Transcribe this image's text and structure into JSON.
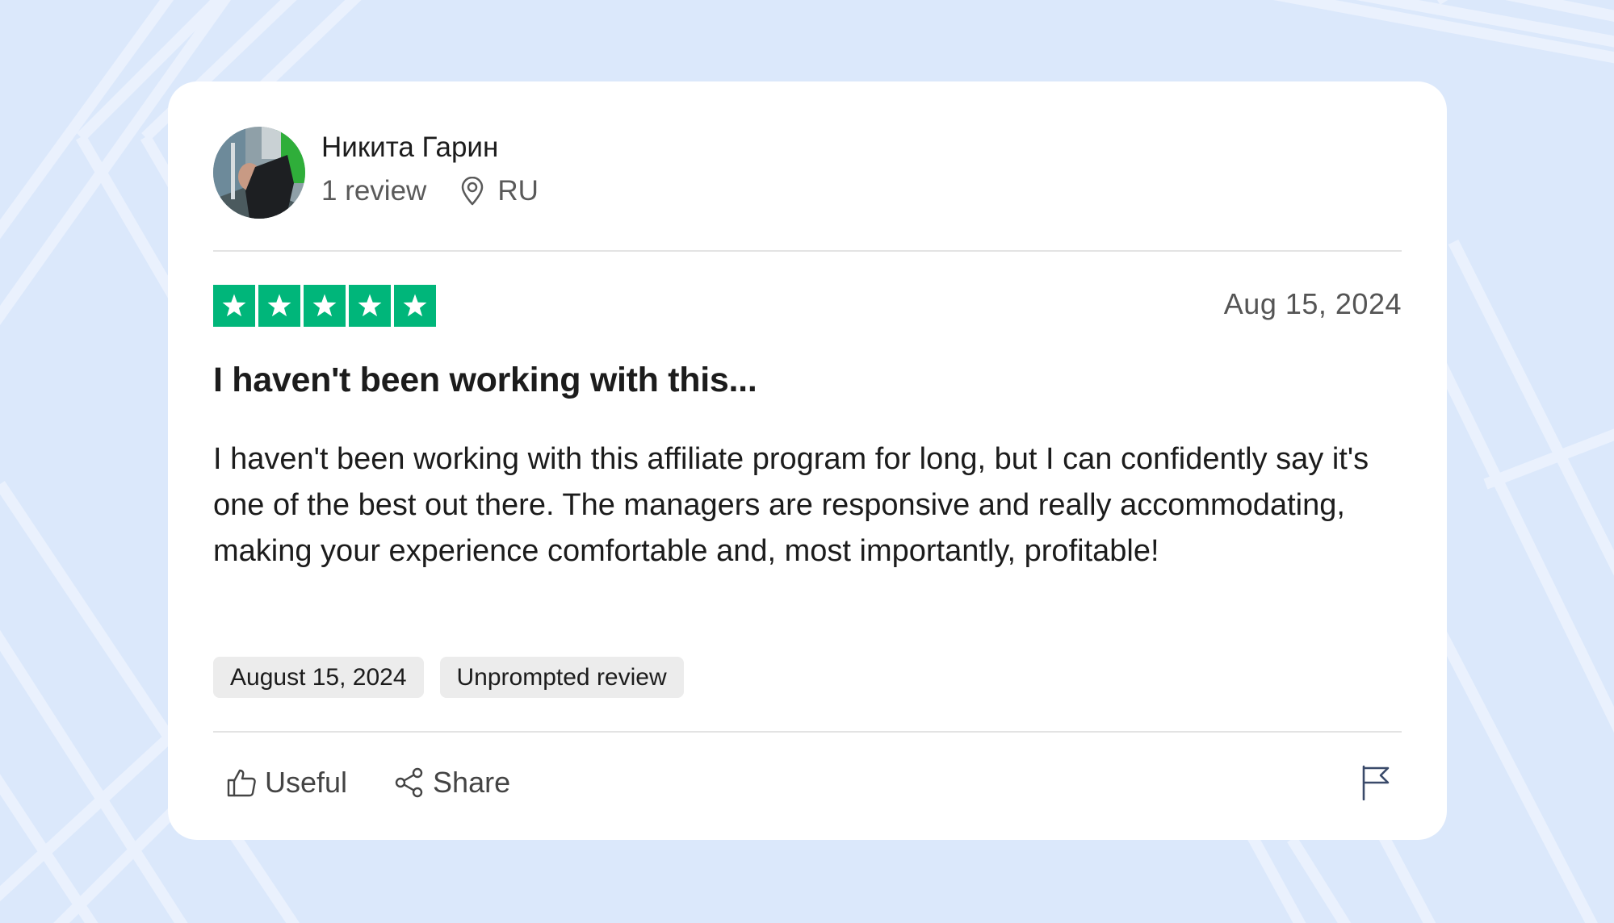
{
  "reviewer": {
    "name": "Никита Гарин",
    "review_count": "1 review",
    "country": "RU"
  },
  "review": {
    "rating": 5,
    "rating_max": 5,
    "date": "Aug 15, 2024",
    "title": "I haven't been working with this...",
    "body": "I haven't been working with this affiliate program for long, but I can confidently say it's one of the best out there. The managers are responsive and really accommodating, making your experience comfortable and, most importantly, profitable!",
    "tags": [
      "August 15, 2024",
      "Unprompted review"
    ]
  },
  "actions": {
    "useful_label": "Useful",
    "share_label": "Share"
  },
  "colors": {
    "star_green": "#00b67a",
    "background": "#dbe8fb",
    "card": "#ffffff",
    "tag_bg": "#ececec"
  },
  "icons": [
    "avatar-photo",
    "location-pin-icon",
    "star-icon",
    "thumbs-up-icon",
    "share-icon",
    "flag-icon"
  ]
}
